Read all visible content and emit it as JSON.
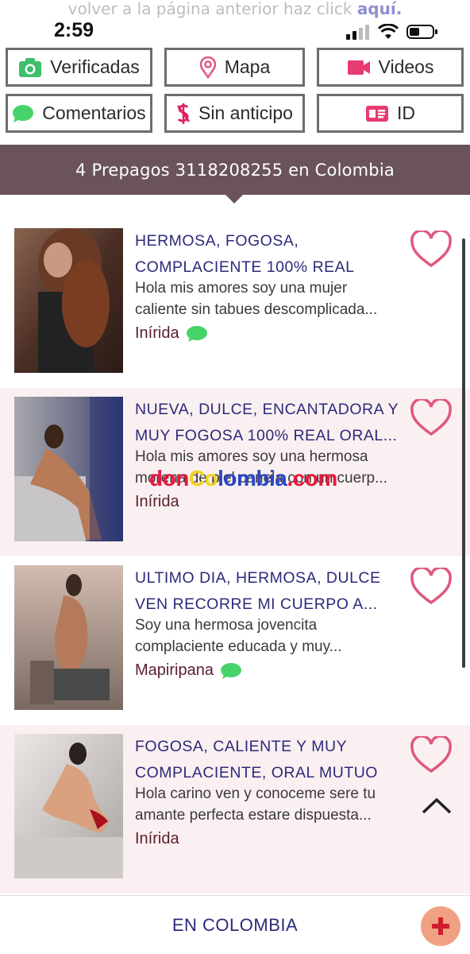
{
  "top_hint": {
    "text": "volver a la página anterior haz click ",
    "link": "aquí."
  },
  "status_bar": {
    "time": "2:59"
  },
  "filters": [
    {
      "label": "Verificadas",
      "icon": "camera-icon"
    },
    {
      "label": "Mapa",
      "icon": "map-pin-icon"
    },
    {
      "label": "Videos",
      "icon": "video-icon"
    },
    {
      "label": "Comentarios",
      "icon": "comment-icon"
    },
    {
      "label": "Sin anticipo",
      "icon": "no-money-icon"
    },
    {
      "label": "ID",
      "icon": "id-card-icon"
    }
  ],
  "results_banner": "4 Prepagos 3118208255 en Colombia",
  "listings": [
    {
      "title": "HERMOSA, FOGOSA, COMPLACIENTE 100% REAL",
      "description": "Hola mis amores soy una mujer caliente sin tabues descomplicada...",
      "city": "Inírida",
      "has_comments": true
    },
    {
      "title": "NUEVA, DULCE, ENCANTADORA Y MUY FOGOSA 100% REAL ORAL...",
      "description": "Hola mis amores soy una hermosa morena de piel canela con un cuerp...",
      "city": "Inírida",
      "has_comments": false
    },
    {
      "title": "ULTIMO DIA, HERMOSA, DULCE VEN RECORRE MI CUERPO A...",
      "description": "Soy una hermosa jovencita complaciente educada y muy...",
      "city": "Mapiripana",
      "has_comments": true
    },
    {
      "title": "FOGOSA, CALIENTE Y MUY COMPLACIENTE, ORAL MUTUO",
      "description": "Hola carino ven y conoceme sere tu amante perfecta estare dispuesta...",
      "city": "Inírida",
      "has_comments": false
    }
  ],
  "watermark": {
    "part1": "don",
    "part2": "Co",
    "part3": "lombia",
    "part4": ".com"
  },
  "footer": {
    "label": "EN COLOMBIA"
  },
  "colors": {
    "banner": "#6a5359",
    "title": "#2c2a7a",
    "city": "#5a1f2e",
    "heart": "#e0587c",
    "alt_row": "#fbf0f1",
    "comment_bubble": "#46d46a",
    "fab": "#f1a183",
    "fab_plus": "#d11d2f"
  }
}
